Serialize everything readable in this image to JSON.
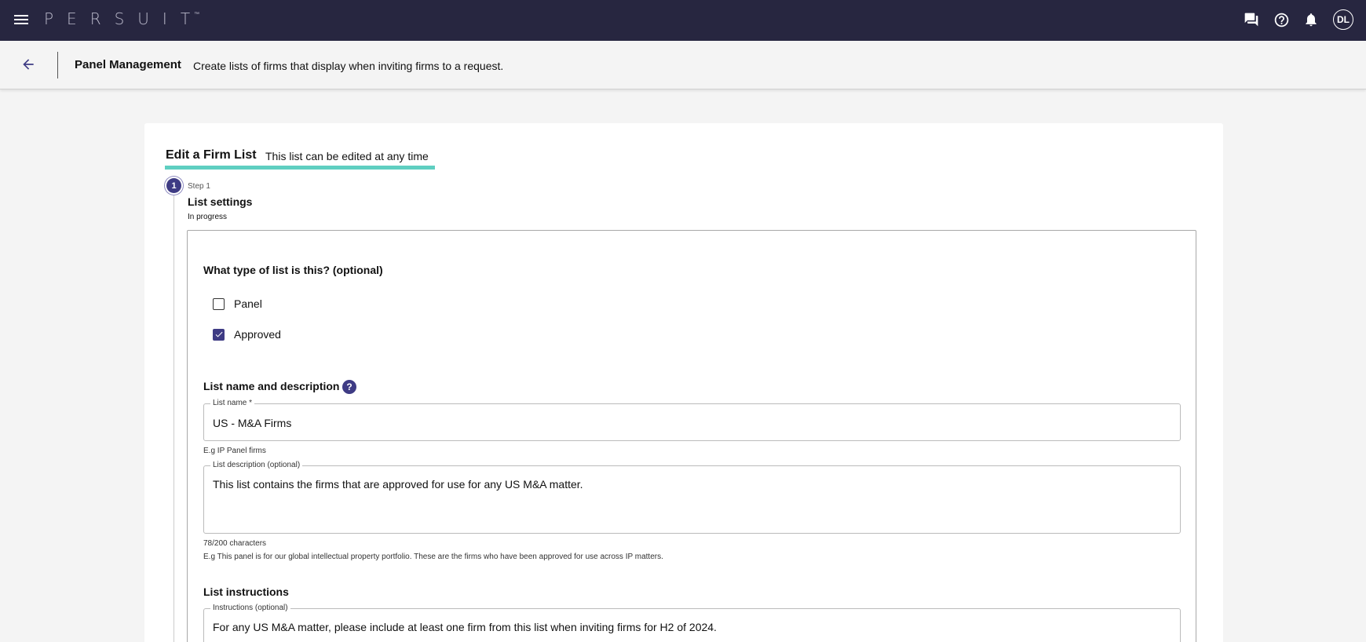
{
  "topbar": {
    "logo": "PERSUIT",
    "logo_tm": "™",
    "avatar_initials": "DL",
    "icons": [
      "menu-icon",
      "chat-icon",
      "help-icon",
      "notification-bell-icon"
    ]
  },
  "subheader": {
    "title": "Panel Management",
    "description": "Create lists of firms that display when inviting firms to a request."
  },
  "card": {
    "title": "Edit a Firm List",
    "subtitle": "This list can be edited at any time"
  },
  "step": {
    "number": "1",
    "label": "Step 1",
    "title": "List settings",
    "status": "In progress"
  },
  "list_type": {
    "heading": "What type of list is this? (optional)",
    "options": [
      {
        "label": "Panel",
        "checked": false
      },
      {
        "label": "Approved",
        "checked": true
      }
    ]
  },
  "name_description": {
    "heading": "List name and description",
    "help_icon": "?",
    "name_field": {
      "label": "List name *",
      "value": "US - M&A Firms",
      "helper": "E.g IP Panel firms"
    },
    "description_field": {
      "label": "List description (optional)",
      "value": "This list contains the firms that are approved for use for any US M&A matter.",
      "counter": "78/200 characters",
      "helper": "E.g This panel is for our global intellectual property portfolio. These are the firms who have been approved for use across IP matters."
    }
  },
  "instructions": {
    "heading": "List instructions",
    "field_label": "Instructions (optional)",
    "value": "For any US M&A matter, please include at least one firm from this list when inviting firms for H2 of 2024."
  },
  "colors": {
    "topbar_bg": "#272640",
    "accent": "#3e3b84",
    "tab_underline": "#5fcfc1"
  }
}
